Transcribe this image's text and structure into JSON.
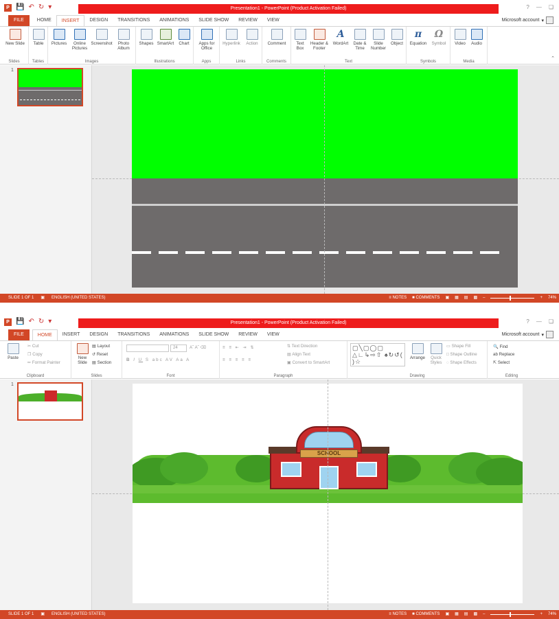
{
  "window_title": "Presentation1 - PowerPoint (Product Activation Failed)",
  "account": "Microsoft account",
  "tabs": [
    "FILE",
    "HOME",
    "INSERT",
    "DESIGN",
    "TRANSITIONS",
    "ANIMATIONS",
    "SLIDE SHOW",
    "REVIEW",
    "VIEW"
  ],
  "insert_ribbon": {
    "groups": [
      "Slides",
      "Tables",
      "Images",
      "Illustrations",
      "Apps",
      "Links",
      "Comments",
      "Text",
      "Symbols",
      "Media"
    ],
    "buttons": {
      "new_slide": "New Slide",
      "table": "Table",
      "pictures": "Pictures",
      "online_pictures": "Online Pictures",
      "screenshot": "Screenshot",
      "photo_album": "Photo Album",
      "shapes": "Shapes",
      "smartart": "SmartArt",
      "chart": "Chart",
      "apps_for_office": "Apps for Office",
      "hyperlink": "Hyperlink",
      "action": "Action",
      "comment": "Comment",
      "text_box": "Text Box",
      "header_footer": "Header & Footer",
      "wordart": "WordArt",
      "date_time": "Date & Time",
      "slide_number": "Slide Number",
      "object": "Object",
      "equation": "Equation",
      "symbol": "Symbol",
      "video": "Video",
      "audio": "Audio"
    }
  },
  "home_ribbon": {
    "groups": [
      "Clipboard",
      "Slides",
      "Font",
      "Paragraph",
      "Drawing",
      "Editing"
    ],
    "paste": "Paste",
    "cut": "Cut",
    "copy": "Copy",
    "format_painter": "Format Painter",
    "new_slide": "New Slide",
    "layout": "Layout",
    "reset": "Reset",
    "section": "Section",
    "font_size": "24",
    "text_direction": "Text Direction",
    "align_text": "Align Text",
    "convert_smartart": "Convert to SmartArt",
    "arrange": "Arrange",
    "quick_styles": "Quick Styles",
    "shape_fill": "Shape Fill",
    "shape_outline": "Shape Outline",
    "shape_effects": "Shape Effects",
    "find": "Find",
    "replace": "Replace",
    "select": "Select"
  },
  "thumbnail_number": "1",
  "school_sign": "SCHOOL",
  "status": {
    "slide": "SLIDE 1 OF 1",
    "language": "ENGLISH (UNITED STATES)",
    "notes": "NOTES",
    "comments": "COMMENTS",
    "zoom": "74%"
  },
  "colors": {
    "accent": "#d24726",
    "title_bar_red": "#ee1c1c",
    "grass_green": "#00ff00",
    "road_gray": "#6e6b6b"
  }
}
